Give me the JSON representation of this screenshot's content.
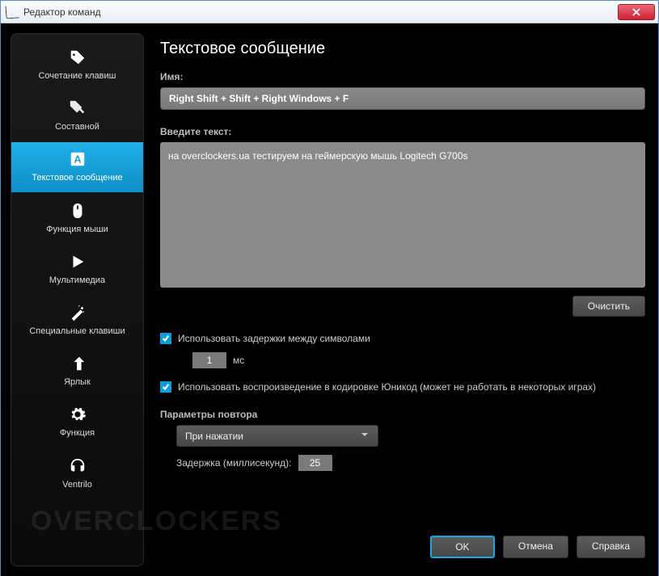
{
  "window": {
    "title": "Редактор команд"
  },
  "sidebar": {
    "items": [
      {
        "label": "Сочетание клавиш",
        "icon": "tag"
      },
      {
        "label": "Составной",
        "icon": "tags"
      },
      {
        "label": "Текстовое сообщение",
        "icon": "text",
        "active": true
      },
      {
        "label": "Функция мыши",
        "icon": "mouse"
      },
      {
        "label": "Мультимедиа",
        "icon": "play"
      },
      {
        "label": "Специальные клавиши",
        "icon": "wand"
      },
      {
        "label": "Ярлык",
        "icon": "shortcut"
      },
      {
        "label": "Функция",
        "icon": "gear"
      },
      {
        "label": "Ventrilo",
        "icon": "headset"
      }
    ]
  },
  "main": {
    "heading": "Текстовое сообщение",
    "name_label": "Имя:",
    "name_value": "Right Shift + Shift + Right Windows + F",
    "text_label": "Введите текст:",
    "text_value": "на overclockers.ua тестируем на геймерскую мышь Logitech G700s",
    "clear_button": "Очистить",
    "use_delay_label": "Использовать задержки между символами",
    "delay_value": "1",
    "delay_unit": "мс",
    "use_unicode_label": "Использовать воспроизведение в кодировке Юникод (может не работать в некоторых играх)",
    "repeat_section": "Параметры повтора",
    "repeat_mode": "При нажатии",
    "repeat_delay_label": "Задержка (миллисекунд):",
    "repeat_delay_value": "25"
  },
  "footer": {
    "ok": "OK",
    "cancel": "Отмена",
    "help": "Справка"
  },
  "watermark": "OVERCLOCKERS"
}
